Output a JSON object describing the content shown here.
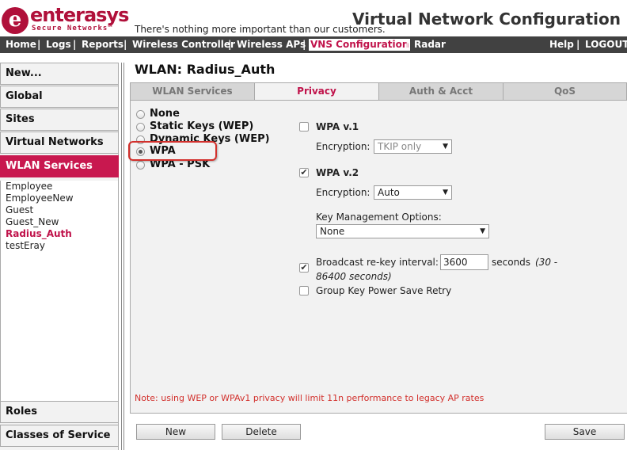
{
  "header": {
    "logo_mark": "e",
    "logo_name": "enterasys",
    "logo_subtitle": "Secure Networks™",
    "tagline": "There's nothing more important than our customers.",
    "app_title": "Virtual Network Configuration"
  },
  "nav": {
    "items": [
      "Home",
      "Logs",
      "Reports",
      "Wireless Controller",
      "Wireless APs",
      "VNS Configuration",
      "Radar"
    ],
    "active": "VNS Configuration",
    "separator": "|",
    "right": [
      "Help",
      "LOGOUT"
    ]
  },
  "sidebar": {
    "top": [
      "New...",
      "Global",
      "Sites",
      "Virtual Networks",
      "WLAN Services"
    ],
    "active": "WLAN Services",
    "wlan_list": [
      "Employee",
      "EmployeeNew",
      "Guest",
      "Guest_New",
      "Radius_Auth",
      "testEray"
    ],
    "wlan_active": "Radius_Auth",
    "bottom": [
      "Roles",
      "Classes of Service"
    ]
  },
  "page": {
    "title": "WLAN: Radius_Auth"
  },
  "tabs": [
    "WLAN Services",
    "Privacy",
    "Auth & Acct",
    "QoS"
  ],
  "active_tab": "Privacy",
  "privacy": {
    "options": [
      "None",
      "Static Keys (WEP)",
      "Dynamic Keys (WEP)",
      "WPA",
      "WPA - PSK"
    ],
    "selected": "WPA",
    "wpa1": {
      "label": "WPA v.1",
      "checked": false,
      "encryption_label": "Encryption:",
      "encryption_value": "TKIP only"
    },
    "wpa2": {
      "label": "WPA v.2",
      "checked": true,
      "encryption_label": "Encryption:",
      "encryption_value": "Auto"
    },
    "key_mgmt_label": "Key Management Options:",
    "key_mgmt_value": "None",
    "rekey": {
      "checked": true,
      "label": "Broadcast re-key interval:",
      "value": "3600",
      "unit": "seconds",
      "range": "(30 -",
      "range2": "86400 seconds)"
    },
    "group_key": {
      "checked": false,
      "label": "Group Key Power Save Retry"
    },
    "note": "Note: using WEP or WPAv1 privacy will limit 11n performance to legacy AP rates"
  },
  "buttons": {
    "new": "New",
    "delete": "Delete",
    "save": "Save"
  },
  "colors": {
    "brand": "#b0103a",
    "accent": "#c8184f",
    "nav_bg": "#414141",
    "highlight": "#d2302c"
  },
  "icons": {
    "checkmark": "✔",
    "dropdown": "▼"
  }
}
